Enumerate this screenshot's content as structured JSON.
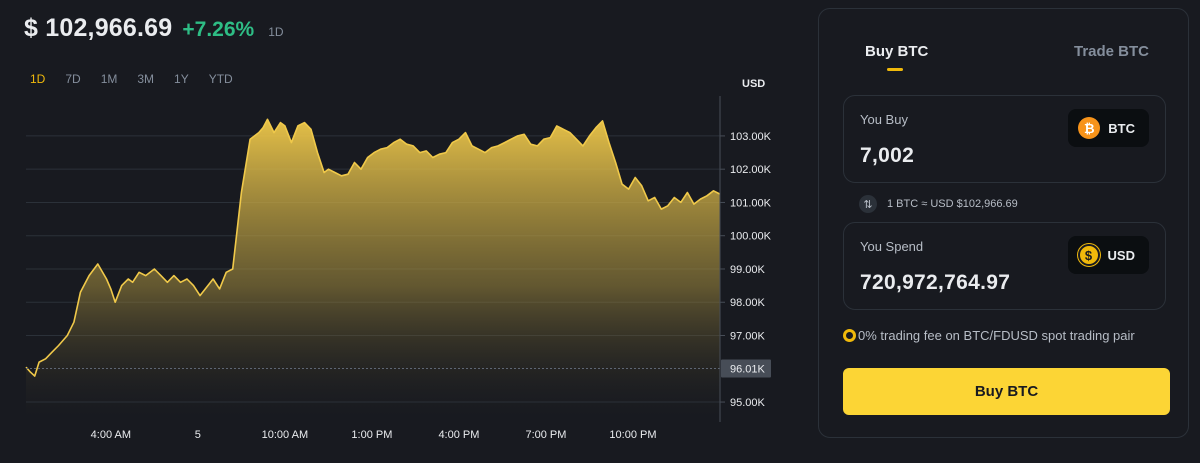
{
  "header": {
    "price": "$ 102,966.69",
    "change": "+7.26%",
    "period": "1D"
  },
  "ranges": [
    "1D",
    "7D",
    "1M",
    "3M",
    "1Y",
    "YTD"
  ],
  "active_range": "1D",
  "colors": {
    "accent": "#f0b90b",
    "positive": "#2ebd85",
    "line": "#f0c94a",
    "button": "#fcd535",
    "background": "#181a20"
  },
  "chart_data": {
    "type": "area",
    "currency_label": "USD",
    "y_ticks": [
      "103.00K",
      "102.00K",
      "101.00K",
      "100.00K",
      "99.00K",
      "98.00K",
      "97.00K",
      "96.01K",
      "95.00K"
    ],
    "y_tick_values": [
      103000,
      102000,
      101000,
      100000,
      99000,
      98000,
      97000,
      96010,
      95000
    ],
    "reference_value": 96010,
    "reference_label": "96.01K",
    "ylim": [
      94400,
      104200
    ],
    "x_ticks": [
      {
        "label": "4:00 AM",
        "x": 4.0
      },
      {
        "label": "5",
        "x": 8.0
      },
      {
        "label": "10:00 AM",
        "x": 12.0
      },
      {
        "label": "1:00 PM",
        "x": 16.0
      },
      {
        "label": "4:00 PM",
        "x": 20.0
      },
      {
        "label": "7:00 PM",
        "x": 24.0
      },
      {
        "label": "10:00 PM",
        "x": 28.0
      }
    ],
    "xlim": [
      0.1,
      32.0
    ],
    "grid": true,
    "x": [
      0.1,
      0.3,
      0.5,
      0.7,
      1.0,
      1.3,
      1.6,
      2.0,
      2.3,
      2.6,
      3.0,
      3.4,
      3.8,
      4.0,
      4.2,
      4.5,
      4.8,
      5.0,
      5.3,
      5.6,
      6.0,
      6.3,
      6.6,
      6.9,
      7.2,
      7.5,
      7.8,
      8.1,
      8.4,
      8.7,
      9.0,
      9.3,
      9.6,
      10.0,
      10.4,
      10.8,
      11.0,
      11.2,
      11.5,
      11.8,
      12.0,
      12.3,
      12.6,
      12.9,
      13.2,
      13.5,
      13.8,
      14.0,
      14.3,
      14.6,
      14.9,
      15.2,
      15.5,
      15.8,
      16.1,
      16.4,
      16.7,
      17.0,
      17.3,
      17.6,
      17.9,
      18.2,
      18.5,
      18.8,
      19.1,
      19.4,
      19.7,
      20.0,
      20.3,
      20.6,
      20.9,
      21.2,
      21.5,
      21.8,
      22.1,
      22.4,
      22.7,
      23.0,
      23.3,
      23.6,
      23.9,
      24.2,
      24.5,
      24.8,
      25.1,
      25.4,
      25.7,
      26.0,
      26.3,
      26.6,
      26.9,
      27.2,
      27.5,
      27.8,
      28.1,
      28.4,
      28.7,
      29.0,
      29.3,
      29.6,
      29.9,
      30.2,
      30.5,
      30.8,
      31.1,
      31.4,
      31.7,
      32.0
    ],
    "values": [
      96050,
      95900,
      95780,
      96200,
      96300,
      96500,
      96700,
      97000,
      97400,
      98300,
      98800,
      99150,
      98700,
      98400,
      98000,
      98500,
      98700,
      98600,
      98900,
      98800,
      99000,
      98800,
      98600,
      98800,
      98600,
      98700,
      98500,
      98200,
      98450,
      98700,
      98400,
      98900,
      99000,
      101300,
      102900,
      103100,
      103250,
      103500,
      103100,
      103400,
      103300,
      102800,
      103300,
      103400,
      103200,
      102500,
      101900,
      102000,
      101900,
      101800,
      101850,
      102200,
      102000,
      102350,
      102500,
      102600,
      102650,
      102800,
      102900,
      102750,
      102700,
      102500,
      102550,
      102350,
      102450,
      102500,
      102800,
      102900,
      103100,
      102700,
      102600,
      102500,
      102650,
      102700,
      102800,
      102900,
      103000,
      103050,
      102750,
      102700,
      102900,
      102950,
      103300,
      103200,
      103100,
      102900,
      102700,
      103000,
      103250,
      103450,
      102800,
      102200,
      101550,
      101400,
      101750,
      101500,
      101050,
      101150,
      100800,
      100900,
      101150,
      101000,
      101300,
      100950,
      101100,
      101200,
      101350,
      101250
    ]
  },
  "panel": {
    "tabs": [
      "Buy BTC",
      "Trade BTC"
    ],
    "you_buy_label": "You Buy",
    "you_buy_amount": "7,002",
    "buy_asset": "BTC",
    "buy_asset_icon": "bitcoin-icon",
    "rate_text": "1 BTC ≈ USD $102,966.69",
    "you_spend_label": "You Spend",
    "you_spend_amount": "720,972,764.97",
    "spend_asset": "USD",
    "spend_asset_icon": "dollar-icon",
    "fee_text": "0% trading fee on BTC/FDUSD spot trading pair",
    "buy_button": "Buy BTC"
  }
}
